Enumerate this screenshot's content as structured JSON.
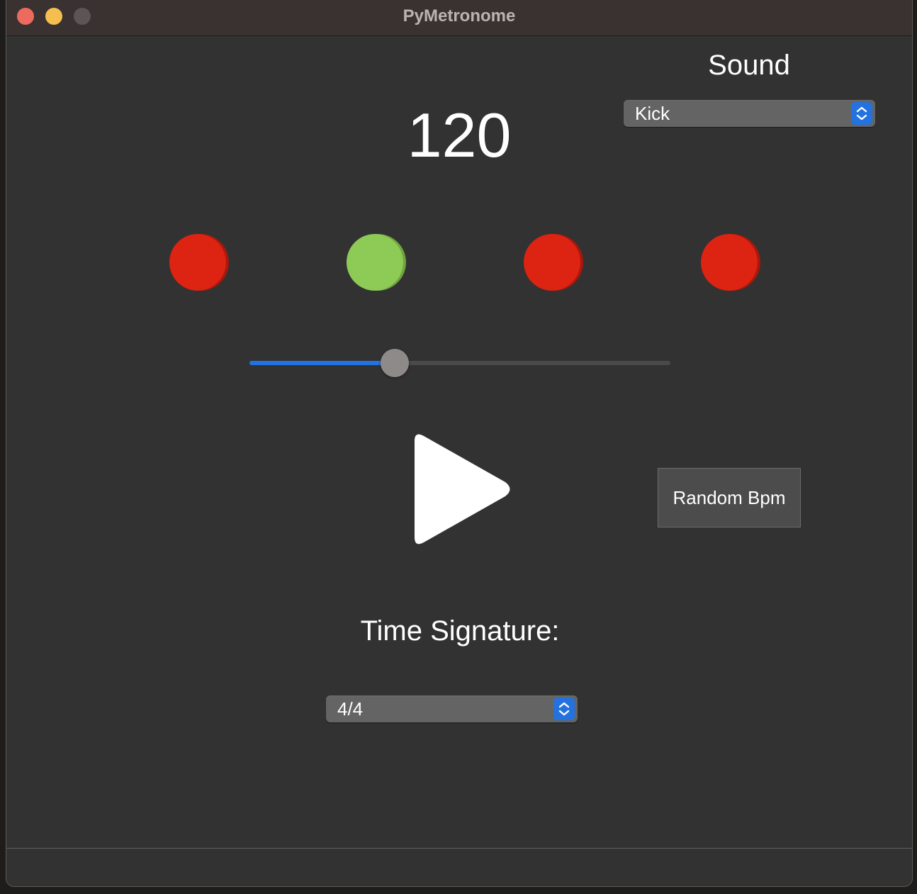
{
  "window": {
    "title": "PyMetronome"
  },
  "sound": {
    "label": "Sound",
    "selected": "Kick"
  },
  "tempo": {
    "bpm": "120",
    "slider_fraction": 0.345
  },
  "beats": [
    {
      "state": "off",
      "color": "#dd2311"
    },
    {
      "state": "on",
      "color": "#8dca56"
    },
    {
      "state": "off",
      "color": "#dd2311"
    },
    {
      "state": "off",
      "color": "#dd2311"
    }
  ],
  "controls": {
    "play_icon": "play-icon",
    "random_bpm_label": "Random Bpm"
  },
  "time_signature": {
    "label": "Time Signature:",
    "selected": "4/4"
  },
  "colors": {
    "accent": "#2372e0",
    "beat_active": "#8dca56",
    "beat_inactive": "#dd2311"
  }
}
